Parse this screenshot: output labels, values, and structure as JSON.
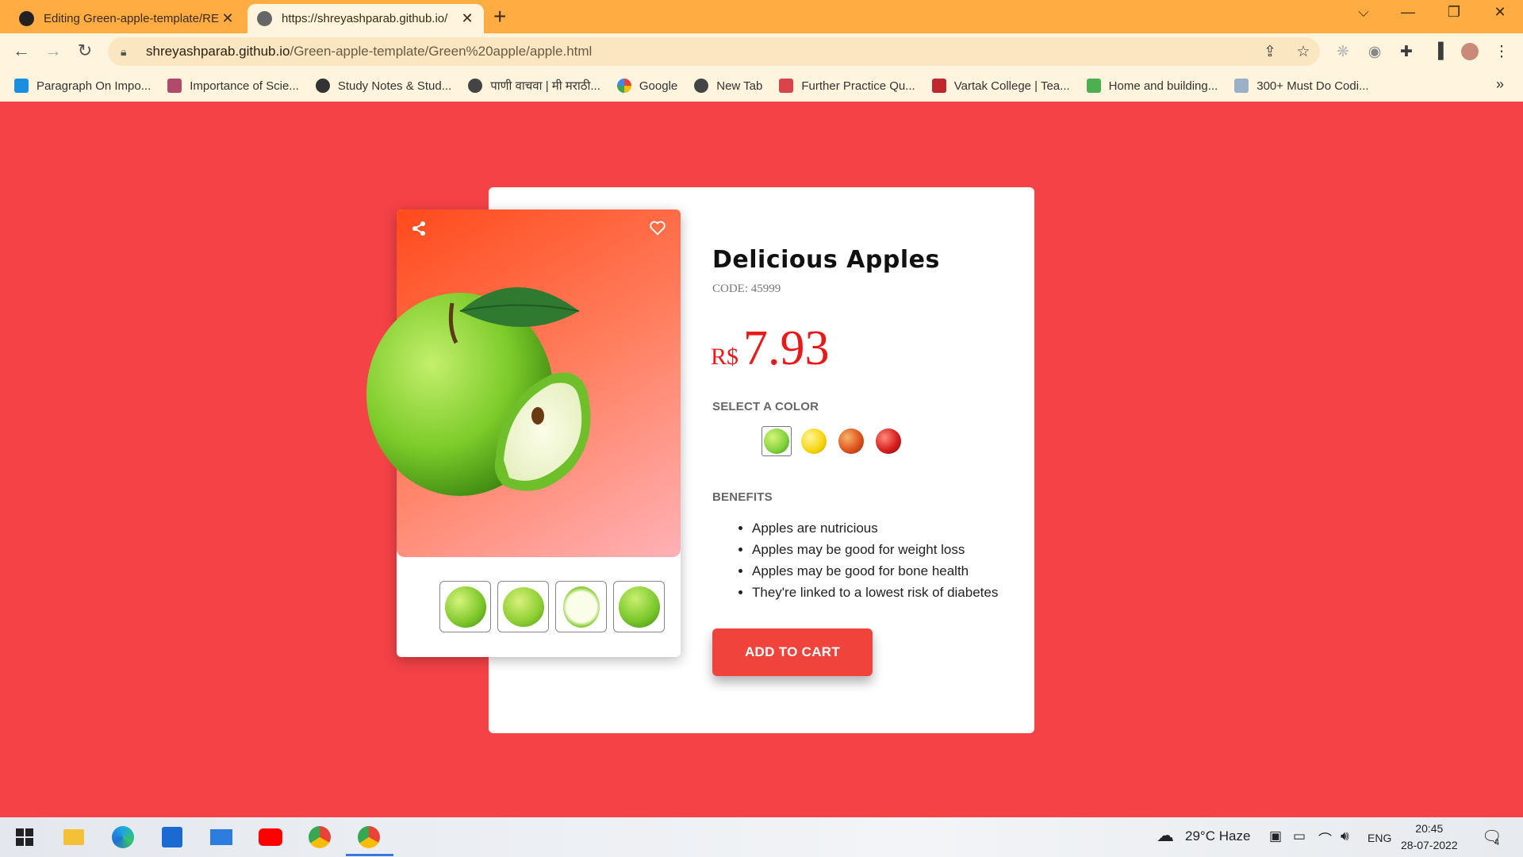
{
  "browser": {
    "tabs": [
      {
        "title": "Editing Green-apple-template/RE",
        "close": "✕"
      },
      {
        "title": "https://shreyashparab.github.io/",
        "close": "✕"
      }
    ],
    "new_tab": "+",
    "url_host": "shreyashparab.github.io",
    "url_path": "/Green-apple-template/Green%20apple/apple.html",
    "bookmarks": [
      "Paragraph On Impo...",
      "Importance of Scie...",
      "Study Notes & Stud...",
      "पाणी वाचवा | मी मराठी...",
      "Google",
      "New Tab",
      "Further Practice Qu...",
      "Vartak College | Tea...",
      "Home and building...",
      "300+ Must Do Codi..."
    ],
    "bookmarks_more": "»"
  },
  "product": {
    "title": "Delicious Apples",
    "code": "CODE: 45999",
    "currency": "R$",
    "price": "7.93",
    "select_color_label": "SELECT A COLOR",
    "colors": [
      "#7fd13b",
      "#f5d40d",
      "#e0541e",
      "#d81f1f"
    ],
    "benefits_label": "BENEFITS",
    "benefits": [
      "Apples are nutricious",
      "Apples may be good for weight loss",
      "Apples may be good for bone health",
      "They're linked to a lowest risk of diabetes"
    ],
    "add_to_cart": "ADD TO CART"
  },
  "colors": {
    "page_bg": "#f44247",
    "accent_red": "#ec1717",
    "tabbar": "#ffad42"
  },
  "taskbar": {
    "weather": "29°C  Haze",
    "lang": "ENG",
    "time": "20:45",
    "date": "28-07-2022",
    "notifications": "4"
  }
}
